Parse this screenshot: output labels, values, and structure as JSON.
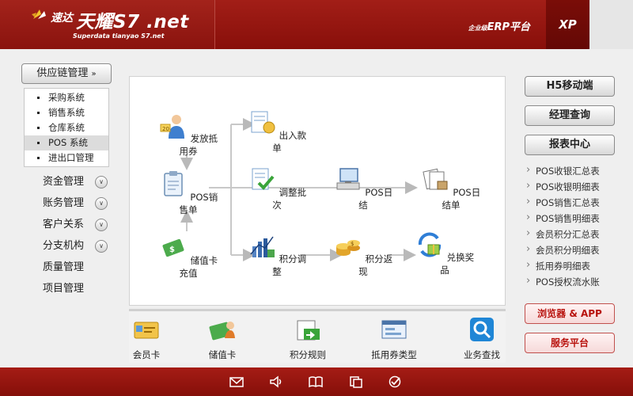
{
  "header": {
    "brand": "速达",
    "product": "天耀S7 .net",
    "subtitle": "Superdata tianyao S7.net",
    "erp_small": "企业级",
    "erp_label": "ERP平台",
    "edition": "XP"
  },
  "left": {
    "supply_chain": "供应链管理",
    "sub_items": [
      "采购系统",
      "销售系统",
      "仓库系统",
      "POS 系统",
      "进出口管理"
    ],
    "menu": [
      "资金管理",
      "账务管理",
      "客户关系",
      "分支机构",
      "质量管理",
      "项目管理"
    ]
  },
  "flow": {
    "issue_voucher": "发放抵用券",
    "pos_sales": "POS销售单",
    "card_recharge": "储值卡充值",
    "in_out": "出入款单",
    "adjust_batch": "调整批次",
    "points_adjust": "积分调整",
    "pos_daily": "POS日结",
    "points_return": "积分返现",
    "pos_daily_bill": "POS日结单",
    "redeem": "兑换奖品"
  },
  "tools": [
    "会员卡",
    "储值卡",
    "积分规则",
    "抵用券类型",
    "业务查找"
  ],
  "right": {
    "h5": "H5移动端",
    "manager": "经理查询",
    "reports": "报表中心",
    "links": [
      "POS收银汇总表",
      "POS收银明细表",
      "POS销售汇总表",
      "POS销售明细表",
      "会员积分汇总表",
      "会员积分明细表",
      "抵用券明细表",
      "POS授权流水账"
    ],
    "browser_app": "浏览器 & APP",
    "service": "服务平台"
  },
  "footer_icons": [
    "mail-icon",
    "sound-icon",
    "book-icon",
    "copy-icon",
    "check-icon"
  ]
}
